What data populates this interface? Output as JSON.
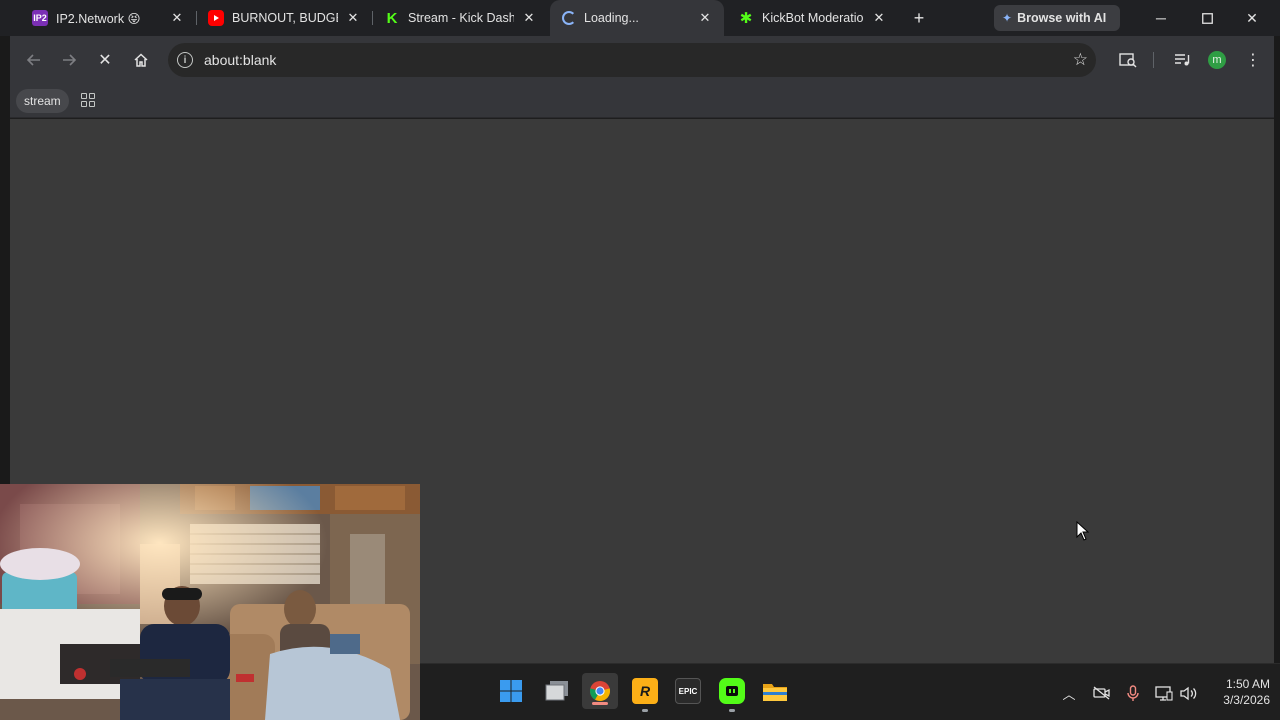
{
  "browser": {
    "tabs": [
      {
        "title": "IP2.Network 😝",
        "favicon": "IP2",
        "favicon_icon": "ip2-favicon-icon",
        "active": false
      },
      {
        "title": "BURNOUT, BUDGET",
        "favicon": "",
        "favicon_icon": "youtube-favicon-icon",
        "active": false
      },
      {
        "title": "Stream - Kick Dashb",
        "favicon": "K",
        "favicon_icon": "kick-favicon-icon",
        "active": false
      },
      {
        "title": "Loading...",
        "favicon": "",
        "favicon_icon": "loading-spinner-icon",
        "active": true
      },
      {
        "title": "KickBot Moderation",
        "favicon": "✱",
        "favicon_icon": "kickbot-favicon-icon",
        "active": false
      }
    ],
    "browse_ai_label": "Browse with AI",
    "address_bar": {
      "url": "about:blank"
    },
    "bookmarks": [
      {
        "label": "stream"
      }
    ],
    "profile_initial": "m",
    "accent_color": "#8ab4f8"
  },
  "taskbar": {
    "apps": [
      {
        "name": "windows-start",
        "icon": "windows-logo-icon"
      },
      {
        "name": "task-view",
        "icon": "task-view-icon"
      },
      {
        "name": "chrome",
        "icon": "chrome-icon",
        "active": true
      },
      {
        "name": "rockstar",
        "icon": "rockstar-icon",
        "label": "R"
      },
      {
        "name": "epic-games",
        "icon": "epic-games-icon",
        "label": "EPIC"
      },
      {
        "name": "kick-studio",
        "icon": "kick-studio-icon"
      },
      {
        "name": "file-explorer",
        "icon": "folder-icon"
      }
    ],
    "clock": {
      "time": "1:50 AM",
      "date": "3/3/2026"
    }
  }
}
